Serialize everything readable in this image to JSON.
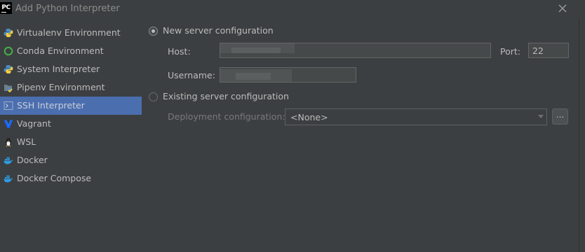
{
  "window": {
    "title": "Add Python Interpreter",
    "app_icon_text": "PC"
  },
  "sidebar": {
    "items": [
      {
        "label": "Virtualenv Environment",
        "icon": "python-icon",
        "selected": false
      },
      {
        "label": "Conda Environment",
        "icon": "conda-icon",
        "selected": false
      },
      {
        "label": "System Interpreter",
        "icon": "python-icon",
        "selected": false
      },
      {
        "label": "Pipenv Environment",
        "icon": "pipenv-icon",
        "selected": false
      },
      {
        "label": "SSH Interpreter",
        "icon": "ssh-terminal-icon",
        "selected": true
      },
      {
        "label": "Vagrant",
        "icon": "vagrant-icon",
        "selected": false
      },
      {
        "label": "WSL",
        "icon": "linux-penguin-icon",
        "selected": false
      },
      {
        "label": "Docker",
        "icon": "docker-icon",
        "selected": false
      },
      {
        "label": "Docker Compose",
        "icon": "docker-icon",
        "selected": false
      }
    ]
  },
  "form": {
    "new_server_label": "New server configuration",
    "new_server_selected": true,
    "host_label": "Host:",
    "host_value": "",
    "port_label": "Port:",
    "port_value": "22",
    "username_label": "Username:",
    "username_value": "",
    "existing_server_label": "Existing server configuration",
    "existing_server_selected": false,
    "deployment_label": "Deployment configuration:",
    "deployment_value": "<None>",
    "browse_label": "..."
  },
  "colors": {
    "background": "#3c3f41",
    "selection": "#4b6eaf",
    "text": "#bbbbbb"
  }
}
